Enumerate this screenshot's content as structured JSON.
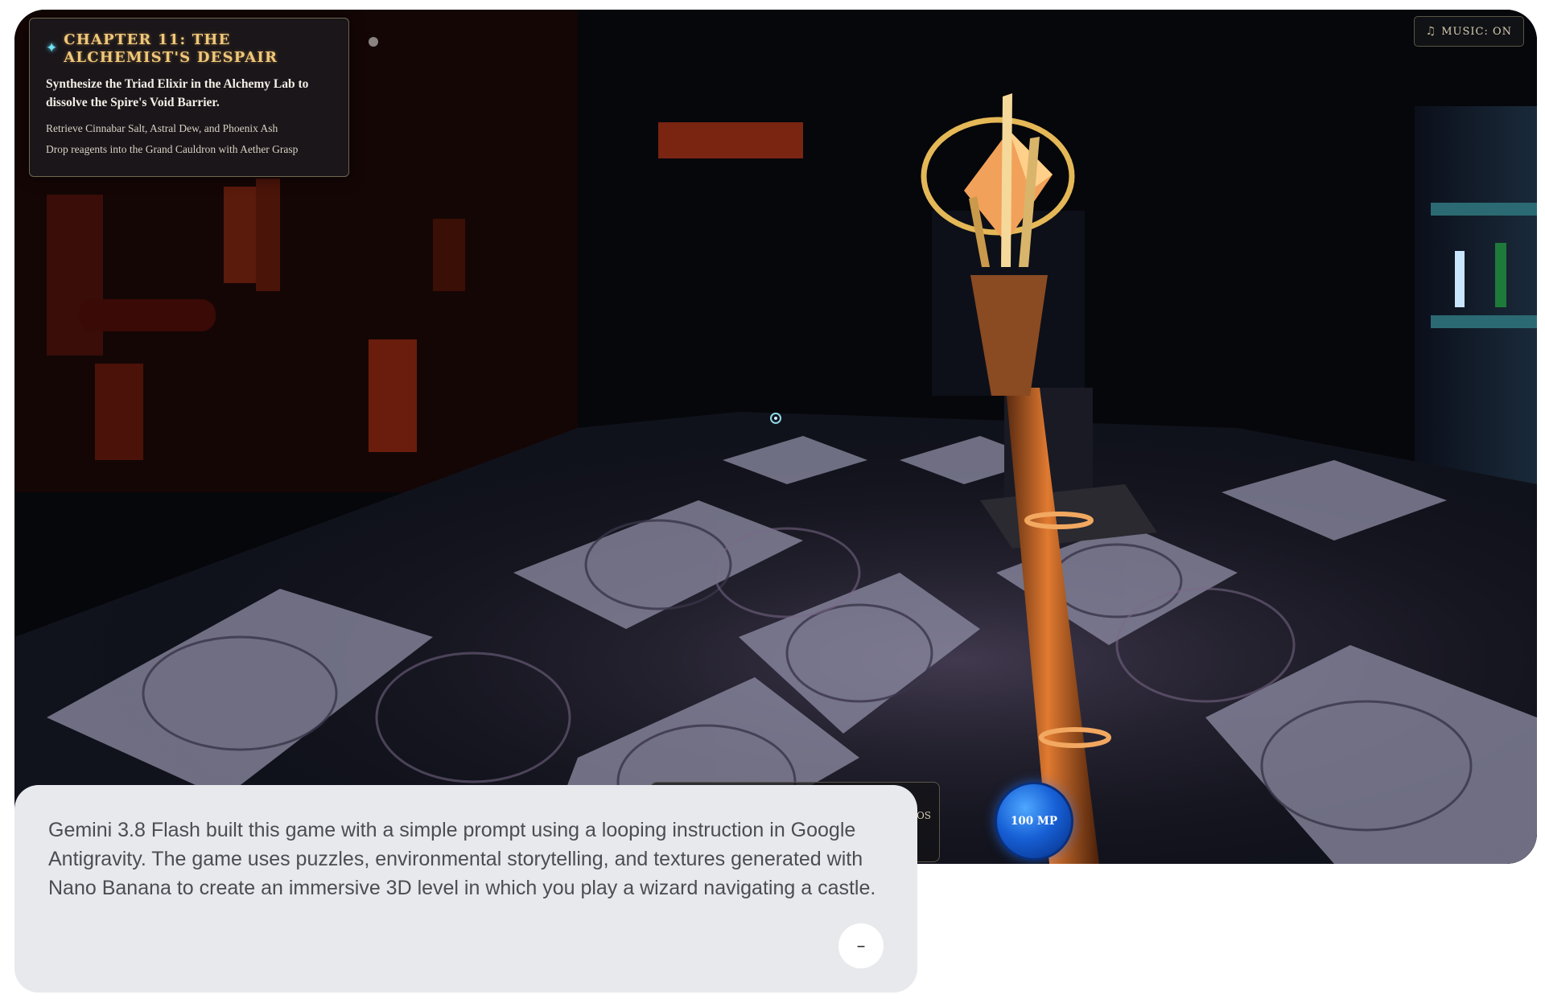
{
  "quest": {
    "icon": "sparkle-icon",
    "title": "Chapter 11: The Alchemist's Despair",
    "objective": "Synthesize the Triad Elixir in the Alchemy Lab to dissolve the Spire's Void Barrier.",
    "steps": [
      "Retrieve Cinnabar Salt, Astral Dew, and Phoenix Ash",
      "Drop reagents into the Grand Cauldron with Aether Grasp"
    ]
  },
  "music": {
    "icon": "music-note-icon",
    "label": "MUSIC: ON"
  },
  "hud": {
    "hotbar_tail": "OS",
    "mana": {
      "label": "100 MP",
      "color": "#1760d6"
    }
  },
  "caption": {
    "text": "Gemini 3.8 Flash built this game with a simple prompt using a looping instruction in Google Antigravity. The game uses puzzles, environmental storytelling, and textures generated with Nano Banana to create an immersive 3D level in which you play a wizard navigating a castle.",
    "collapse_icon": "minus-icon",
    "collapse_label": "–"
  },
  "colors": {
    "quest_title": "#f0c87a",
    "accent_cyan": "#6fe3f2",
    "card_bg": "#e8e9ec"
  }
}
